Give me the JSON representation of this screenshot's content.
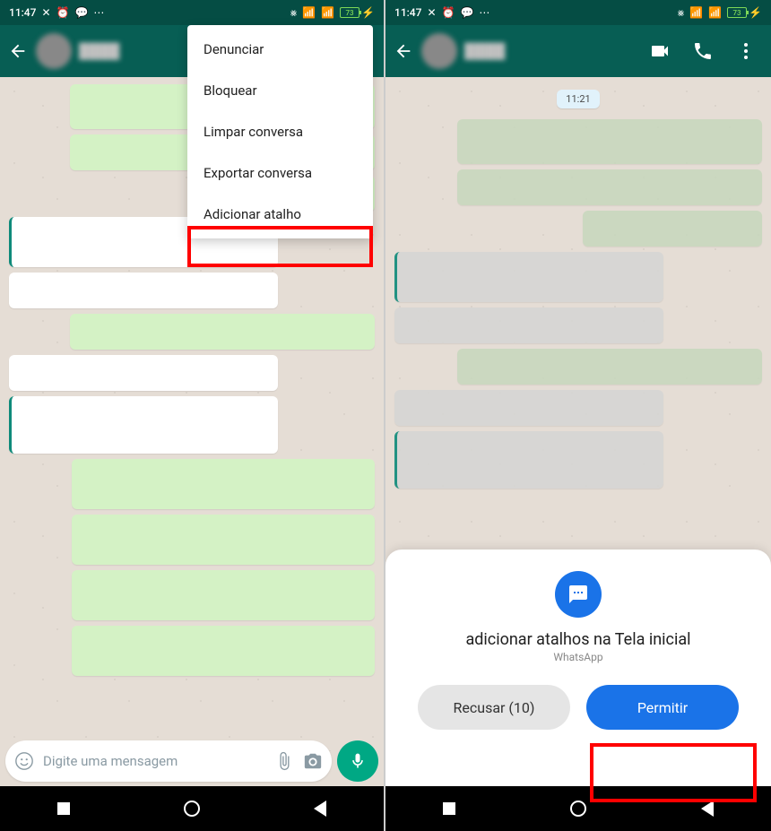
{
  "statusbar": {
    "time": "11:47",
    "battery": "73",
    "lightning": "⚡"
  },
  "menu": {
    "report": "Denunciar",
    "block": "Bloquear",
    "clear": "Limpar conversa",
    "export": "Exportar conversa",
    "shortcut": "Adicionar atalho"
  },
  "chat": {
    "time_divider": "11:21",
    "input_placeholder": "Digite uma mensagem"
  },
  "sheet": {
    "title": "adicionar atalhos na Tela inicial",
    "subtitle": "WhatsApp",
    "deny": "Recusar (10)",
    "allow": "Permitir"
  }
}
